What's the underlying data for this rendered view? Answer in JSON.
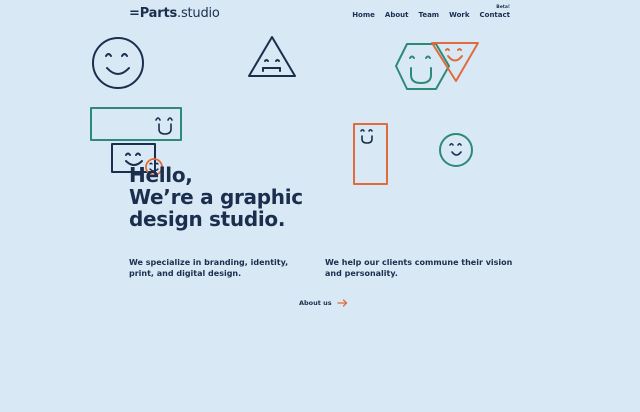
{
  "header": {
    "logo_brand": "=Parts",
    "logo_suffix": ".studio",
    "nav_badge": "Beta!",
    "nav": [
      {
        "label": "Home"
      },
      {
        "label": "About"
      },
      {
        "label": "Team"
      },
      {
        "label": "Work"
      },
      {
        "label": "Contact"
      }
    ]
  },
  "hero": {
    "line1": "Hello,",
    "line2": "We’re a graphic",
    "line3": "design studio."
  },
  "intro_left": {
    "line1": "We specialize in branding, identity,",
    "line2": "print, and digital design."
  },
  "intro_right": {
    "line1": "We help our clients commune their vision",
    "line2": "and personality."
  },
  "about_link": {
    "label": "About us",
    "icon": "arrow-right-icon"
  },
  "colors": {
    "background": "#d8e9f5",
    "text": "#1b2e4e",
    "navy": "#1b2e4e",
    "green": "#2d8a76",
    "orange": "#e06b3c"
  }
}
